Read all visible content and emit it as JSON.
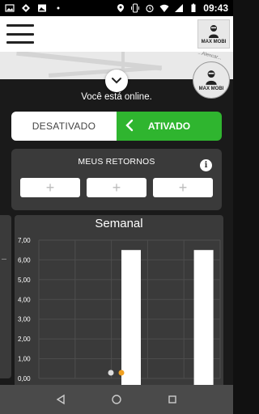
{
  "status_bar": {
    "time": "09:43",
    "left_icons": [
      "image-icon",
      "settings-icon",
      "photo-icon",
      "dots-icon"
    ],
    "right_icons": [
      "location-icon",
      "vibrate-icon",
      "alarm-icon",
      "wifi-icon",
      "signal-icon",
      "battery-icon"
    ]
  },
  "header": {
    "menu_icon": "hamburger-icon",
    "logo_text": "MAX MOBI"
  },
  "map": {
    "street_label": "...Alencar..."
  },
  "floating": {
    "logo_text": "MAX MOBI",
    "toggle_icon": "chevron-down-icon"
  },
  "status": {
    "online_text": "Você está online."
  },
  "switch": {
    "off_label": "DESATIVADO",
    "on_label": "ATIVADO",
    "selected": "on",
    "accent_color": "#2fb52f"
  },
  "returns": {
    "title": "MEUS RETORNOS",
    "info_icon": "info-icon",
    "slots": [
      "+",
      "+",
      "+"
    ]
  },
  "chart_data": {
    "type": "bar",
    "title": "Semanal",
    "y_ticks": [
      "7,00",
      "6,00",
      "5,00",
      "4,00",
      "3,00",
      "2,00",
      "1,00",
      "0,00"
    ],
    "ylim": [
      0,
      7
    ],
    "grid": true,
    "categories": [
      "",
      "",
      "",
      "",
      ""
    ],
    "values": [
      0,
      0,
      6.5,
      0,
      6.5
    ],
    "bar_color": "#ffffff",
    "pager_dots": 2,
    "active_dot": 1,
    "active_dot_color": "#f0a020"
  },
  "nav": {
    "back_icon": "back-triangle-icon",
    "home_icon": "home-circle-icon",
    "recents_icon": "recents-square-icon"
  }
}
